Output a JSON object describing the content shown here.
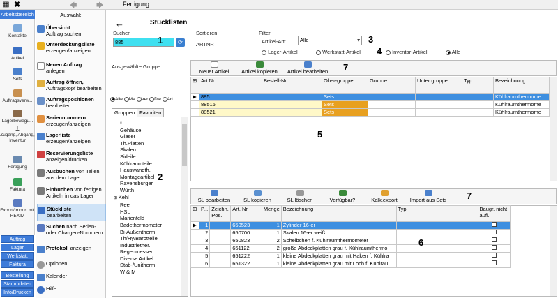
{
  "window": {
    "title": "Fertigung"
  },
  "nav": {
    "active_tab": "Arbeitsbereich"
  },
  "leftbar": {
    "items": [
      {
        "label": "Kontakte",
        "icon": "contacts-icon"
      },
      {
        "label": "Artikel",
        "icon": "article-icon"
      },
      {
        "label": "Sets",
        "icon": "sets-icon"
      },
      {
        "label": "Auftragsverw...",
        "icon": "order-icon"
      },
      {
        "label": "Lagerbewegu...",
        "icon": "warehouse-icon"
      },
      {
        "label": "Zugang, Abgang, Inventur",
        "icon": "plus-minus-icon"
      },
      {
        "label": "Fertigung",
        "icon": "wrench-icon"
      },
      {
        "label": "Faktura",
        "icon": "invoice-icon"
      },
      {
        "label": "Export/Import mit REXIM",
        "icon": "export-icon"
      }
    ],
    "buttons": [
      "Auftrag",
      "Lager",
      "Werkstatt",
      "Faktura",
      "Bestellung",
      "Stammdaten",
      "Info/Drucken"
    ]
  },
  "menu": {
    "title": "Auswahl:",
    "items": [
      {
        "bold": "Übersicht",
        "rest": "Auftrag suchen"
      },
      {
        "bold": "Unterdeckungsliste",
        "rest": "erzeugen/anzeigen"
      },
      {
        "bold": "Neuen Auftrag",
        "rest": "anlegen"
      },
      {
        "bold": "Auftrag öffnen,",
        "rest": "Auftragskopf bearbeiten"
      },
      {
        "bold": "Auftragspositionen",
        "rest": "bearbeiten"
      },
      {
        "bold": "Seriennummern",
        "rest": "erzeugen/anzeigen"
      },
      {
        "bold": "Lagerliste",
        "rest": "erzeugen/anzeigen"
      },
      {
        "bold": "Reservierungsliste",
        "rest": "anzeigen/drucken"
      },
      {
        "bold": "Ausbuchen",
        "rest": "von Teilen aus dem Lager"
      },
      {
        "bold": "Einbuchen",
        "rest": "von fertigen Artikeln in das Lager"
      },
      {
        "bold": "Stückliste",
        "rest": "bearbeiten"
      },
      {
        "bold": "Suchen",
        "rest": "nach Serien- oder Chargen-Nummern"
      },
      {
        "bold": "Protokoll",
        "rest": "anzeigen"
      },
      {
        "bold": "",
        "rest": "Optionen"
      },
      {
        "bold": "",
        "rest": "Kalender"
      },
      {
        "bold": "",
        "rest": "Hilfe"
      }
    ]
  },
  "main": {
    "title": "Stücklisten",
    "search": {
      "label": "Suchen",
      "value": "885"
    },
    "sort": {
      "label": "Sortieren",
      "value": "ARTNR"
    },
    "filter": {
      "label": "Filter",
      "art_label": "Artikel-Art:",
      "art_value": "Alle",
      "radios": [
        "Lager-Artikel",
        "Werkstatt-Artikel",
        "Inventar-Artikel",
        "Alle"
      ]
    },
    "group_label": "Ausgewählte Gruppe",
    "az_radios": [
      "Alle",
      "Me",
      "Ver",
      "Die",
      "Art"
    ],
    "tabs": [
      "Gruppen",
      "Favoriten"
    ],
    "groups": [
      "*",
      "Gehäuse",
      "Gläser",
      "Th.Platten",
      "Skalen",
      "Sideile",
      "Kühlraumteile",
      "Hauswandth.",
      "Montageartikel",
      "Ravensburger",
      "Würth",
      "Kehl",
      "Reel",
      "HSL",
      "Marienfeld",
      "Badethermometer",
      "Bi-Außentherm.",
      "Th/Hy/Barotteile",
      "Industriether.",
      "Regenmesser",
      "Diverse Artikel",
      "Stab-/Unitherm.",
      "W & M"
    ],
    "toolbar1": [
      "Neuer Artikel",
      "Artikel kopieren",
      "Artikel bearbeiten"
    ],
    "table1": {
      "headers": [
        "Art.Nr.",
        "Bestell-Nr.",
        "Ober-gruppe",
        "Gruppe",
        "Unter gruppe",
        "Typ",
        "Bezeichnung"
      ],
      "rows": [
        [
          "885",
          "",
          "Sets",
          "",
          "",
          "",
          "Kühlraumthermome"
        ],
        [
          "88516",
          "",
          "Sets",
          "",
          "",
          "",
          "Kühlraumthermome"
        ],
        [
          "88521",
          "",
          "Sets",
          "",
          "",
          "",
          "Kühlraumthermome"
        ]
      ]
    },
    "toolbar2": [
      "SL bearbeiten",
      "SL kopieren",
      "SL löschen",
      "Verfügbar?",
      "Kalk.export",
      "Import aus Sets"
    ],
    "table2": {
      "headers": [
        "P...",
        "Zeichn. Pos.",
        "Art. Nr.",
        "Menge",
        "Bezeichnung",
        "Typ",
        "Baugr. nicht aufl."
      ],
      "rows": [
        [
          "1",
          "",
          "650523",
          "1",
          "Zylinder 16-er",
          "",
          ""
        ],
        [
          "2",
          "",
          "650700",
          "1",
          "Skalen 16-er weiß",
          "",
          ""
        ],
        [
          "3",
          "",
          "650823",
          "2",
          "Scheibchen f. Kühlraumthermometer",
          "",
          ""
        ],
        [
          "4",
          "",
          "651122",
          "2",
          "große Abdeckplatten grau f. Kühlraumthermo",
          "",
          ""
        ],
        [
          "5",
          "",
          "651222",
          "1",
          "kleine Abdeckplatten grau mit Haken f. Kühlra",
          "",
          ""
        ],
        [
          "6",
          "",
          "651322",
          "1",
          "kleine Abdeckplatten grau mit Loch f. Kühlrau",
          "",
          ""
        ]
      ]
    },
    "markers": [
      "1",
      "2",
      "3",
      "4",
      "5",
      "6",
      "7",
      "7"
    ]
  },
  "colors": {
    "accent": "#3d7bd9",
    "selection": "#3e8fe0",
    "search_bg": "#3fe0f0",
    "yellow": "#fff8c8"
  }
}
